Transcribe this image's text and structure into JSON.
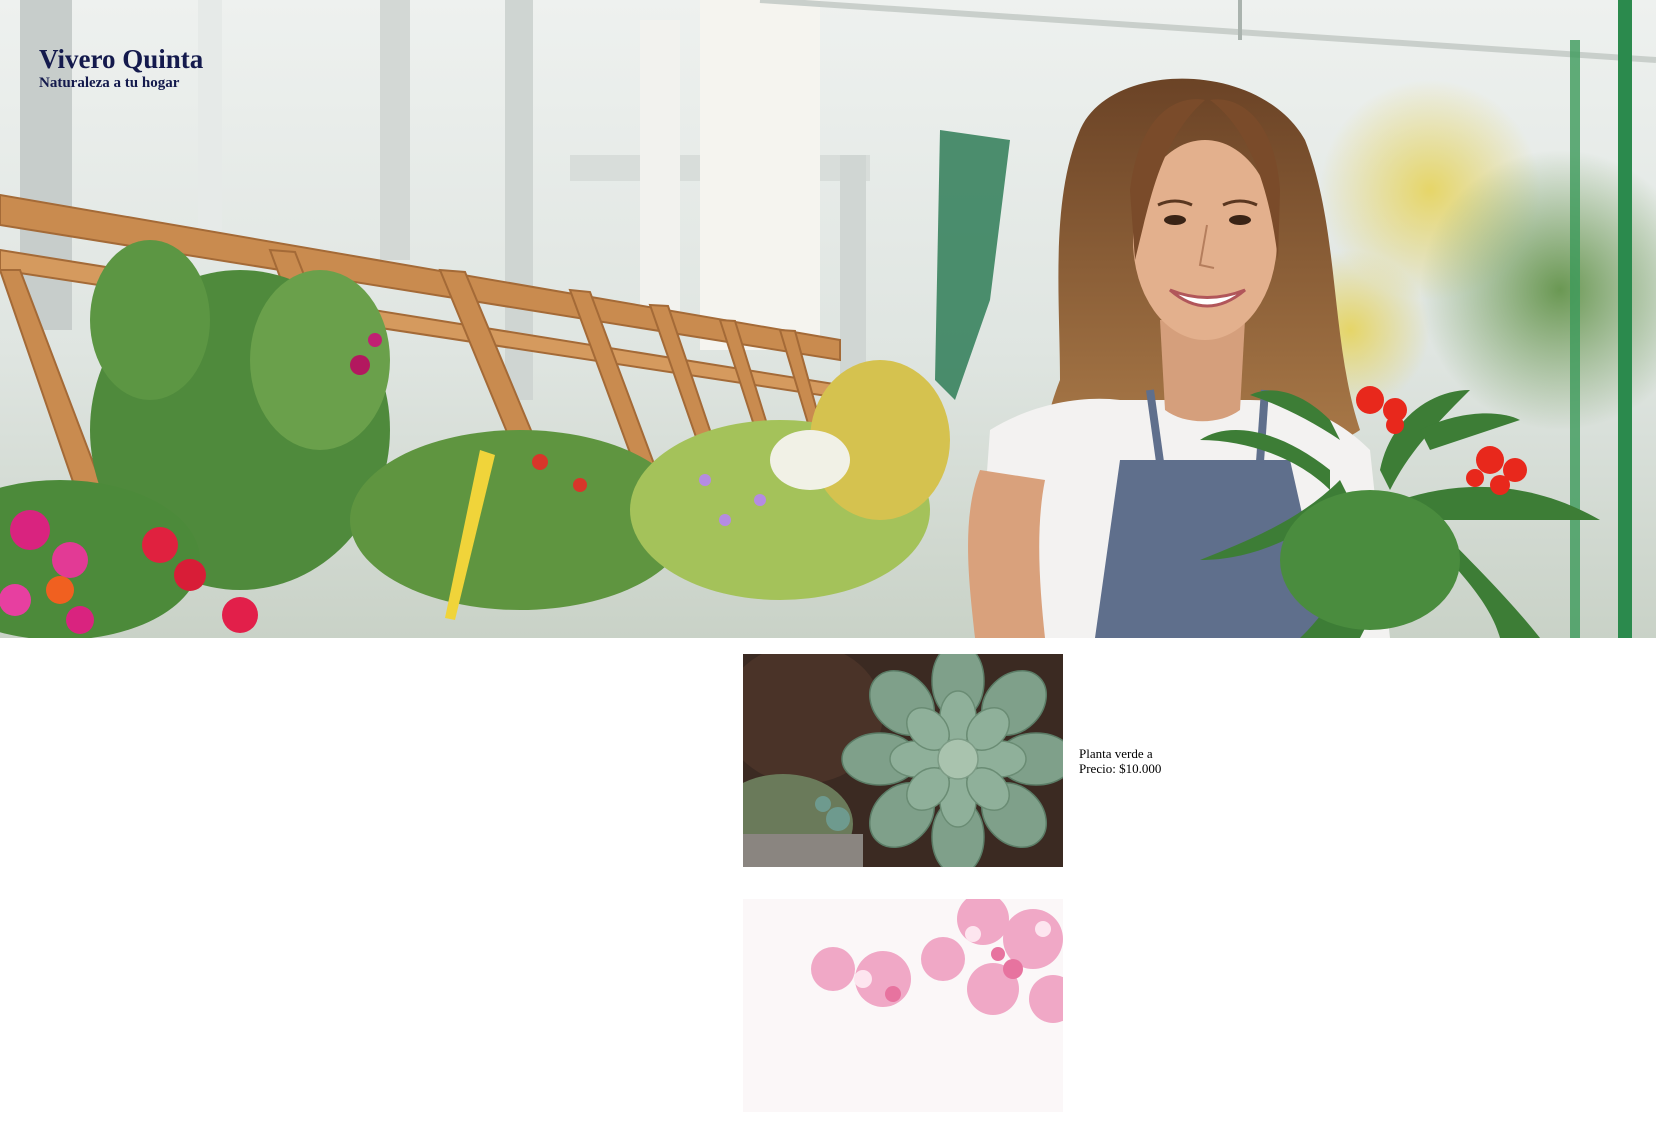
{
  "header": {
    "site_title": "Vivero Quinta",
    "tagline": "Naturaleza a tu hogar"
  },
  "hero": {
    "image_label": "hero-nursery-photo"
  },
  "products": [
    {
      "name": "Planta verde a",
      "price_label": "Precio: $10.000",
      "image_label": "succulent-photo"
    },
    {
      "name": "",
      "price_label": "",
      "image_label": "pink-blossom-photo"
    }
  ],
  "colors": {
    "brand_text": "#141a4d",
    "page_background": "#ffffff"
  }
}
